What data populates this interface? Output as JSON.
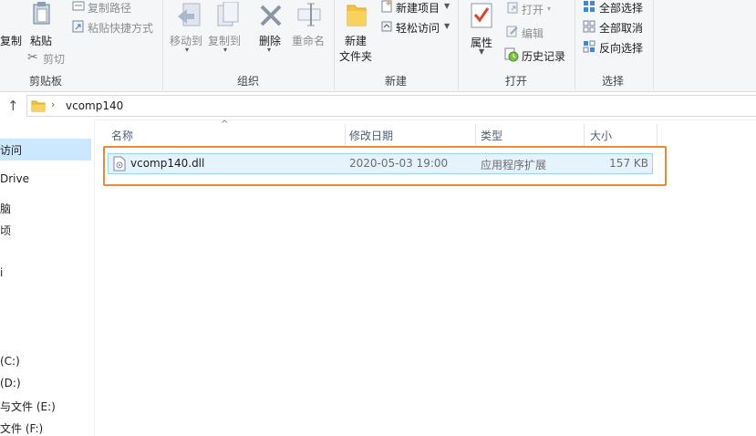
{
  "ribbon": {
    "clipboard": {
      "copy_label": "复制",
      "paste_label": "粘贴",
      "copy_path_label": "复制路径",
      "paste_shortcut_label": "粘贴快捷方式",
      "cut_label": "剪切",
      "group_label": "剪贴板"
    },
    "organize": {
      "move_to_label": "移动到",
      "copy_to_label": "复制到",
      "delete_label": "删除",
      "rename_label": "重命名",
      "group_label": "组织"
    },
    "new": {
      "new_folder_label": "新建\n文件夹",
      "new_folder_line1": "新建",
      "new_folder_line2": "文件夹",
      "new_item_label": "新建项目",
      "easy_access_label": "轻松访问",
      "group_label": "新建"
    },
    "open": {
      "properties_label": "属性",
      "open_label": "打开",
      "edit_label": "编辑",
      "history_label": "历史记录",
      "group_label": "打开"
    },
    "select": {
      "select_all_label": "全部选择",
      "select_none_label": "全部取消",
      "invert_label": "反向选择",
      "group_label": "选择"
    }
  },
  "address": {
    "path_item": "vcomp140"
  },
  "nav": {
    "items": [
      "访问",
      "Drive",
      "脑",
      "顷",
      "",
      "i",
      "",
      "",
      "",
      "(C:)",
      "(D:)",
      "与文件 (E:)",
      "文件 (F:)"
    ]
  },
  "columns": {
    "name": "名称",
    "modified": "修改日期",
    "type": "类型",
    "size": "大小"
  },
  "files": [
    {
      "name": "vcomp140.dll",
      "modified": "2020-05-03 19:00",
      "type": "应用程序扩展",
      "size": "157 KB"
    }
  ],
  "colors": {
    "highlight_box": "#ec8a34",
    "row_selected_border": "#99d1ff",
    "nav_selected_bg": "#cce8ff"
  }
}
